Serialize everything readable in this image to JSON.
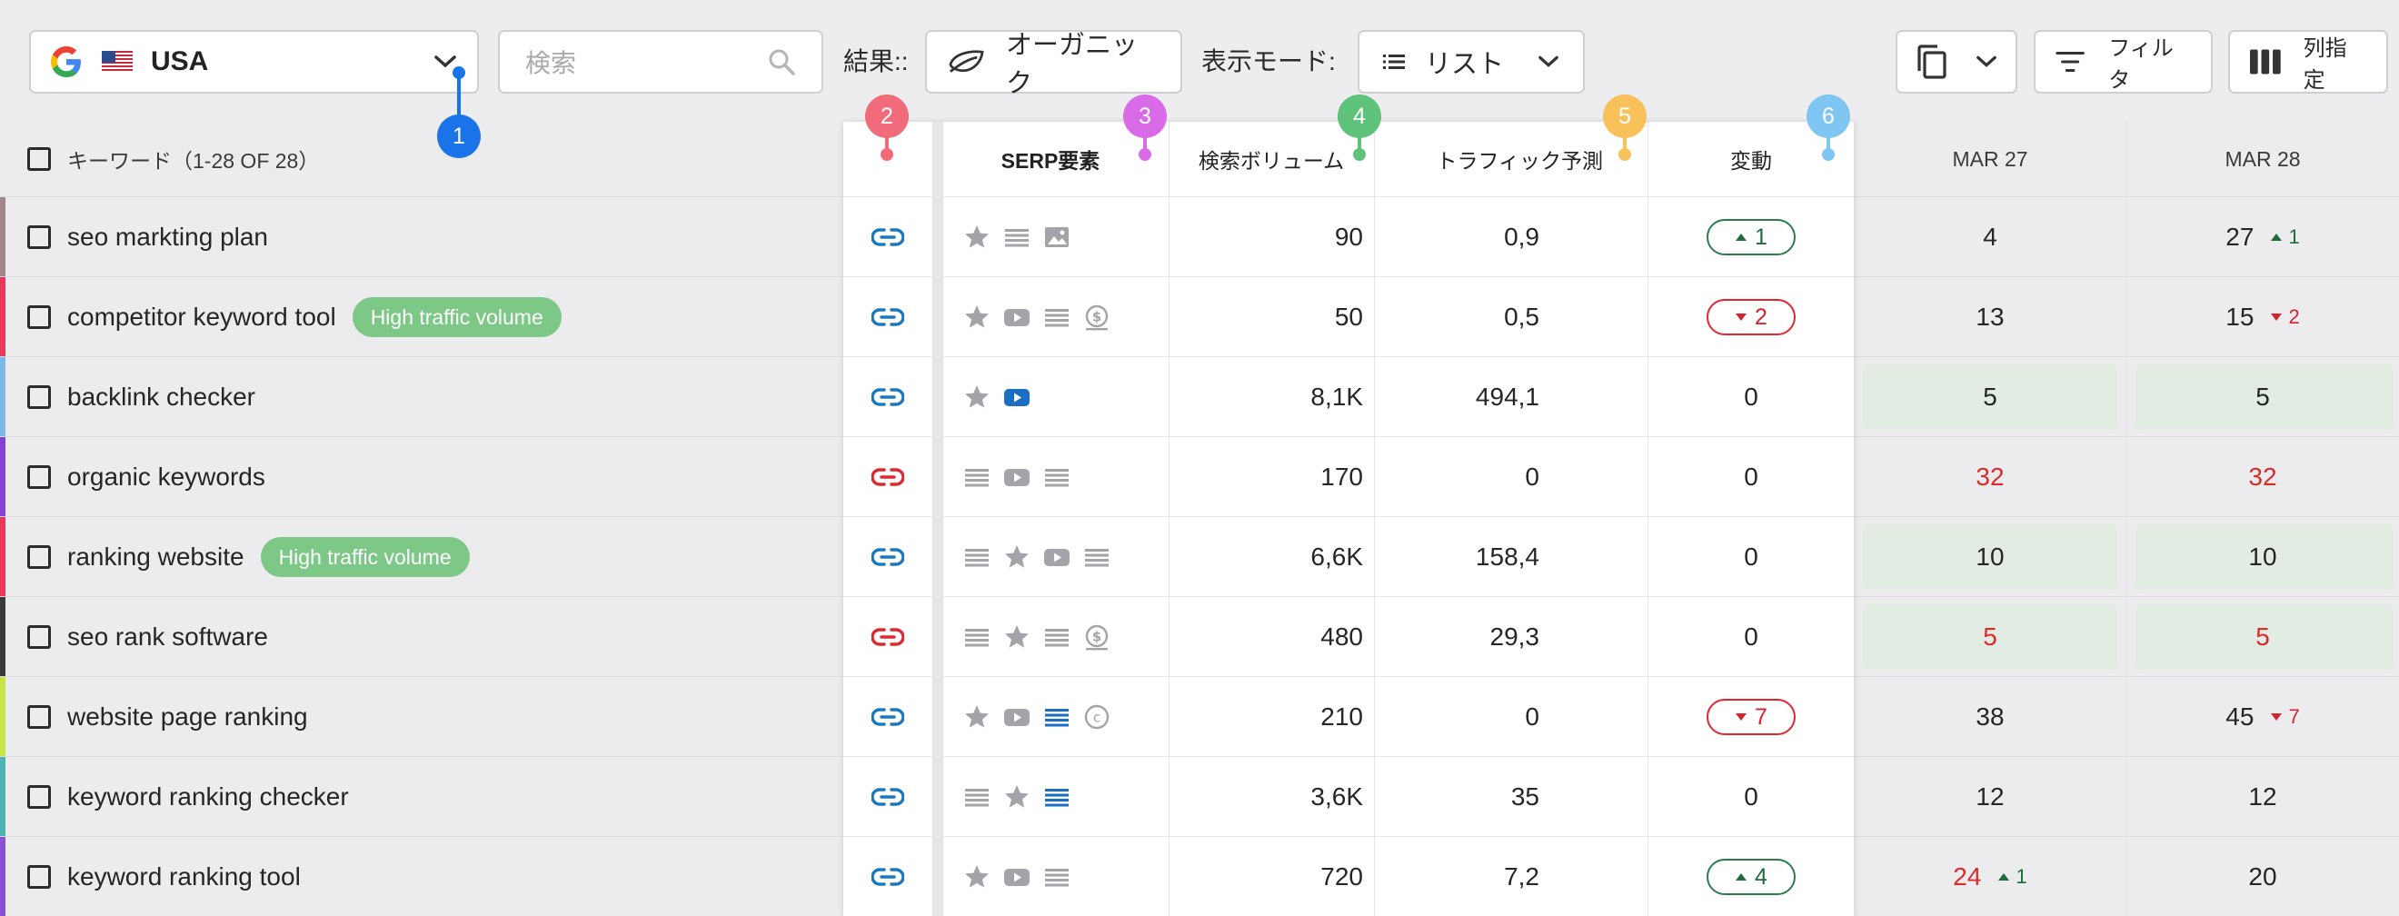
{
  "toolbar": {
    "country": "USA",
    "search_placeholder": "検索",
    "result_label": "結果::",
    "result_value": "オーガニック",
    "mode_label": "表示モード:",
    "mode_value": "リスト",
    "filter_label": "フィルタ",
    "columns_label": "列指定"
  },
  "header": {
    "keyword": "キーワード（1-28 OF 28）",
    "serp": "SERP要素",
    "volume": "検索ボリューム",
    "traffic": "トラフィック予測",
    "change": "変動",
    "date1": "MAR 27",
    "date2": "MAR 28"
  },
  "badges": [
    "1",
    "2",
    "3",
    "4",
    "5",
    "6"
  ],
  "colors": {
    "badge1": "#1a73e8",
    "badge2": "#f26b7a",
    "badge3": "#d96be8",
    "badge4": "#5ec27a",
    "badge5": "#f8c15a",
    "badge6": "#7fc6f2",
    "link_blue": "#1a78c2",
    "link_red": "#e0262f",
    "tag_green": "#7dc787"
  },
  "rows": [
    {
      "keyword": "seo markting plan",
      "tag": "",
      "stripe": "#a0868a",
      "link": "blue",
      "serp": [
        "star",
        "lines",
        "image"
      ],
      "volume": "90",
      "traffic": "0,9",
      "change": {
        "dir": "up",
        "value": "1"
      },
      "d1": "4",
      "d1_red": false,
      "d1_delta": "",
      "d2": "27",
      "d2_red": false,
      "d2_delta": {
        "dir": "up",
        "value": "1"
      },
      "hl": false
    },
    {
      "keyword": "competitor keyword tool",
      "tag": "High traffic volume",
      "stripe": "#e8395a",
      "link": "blue",
      "serp": [
        "star",
        "video",
        "lines",
        "money"
      ],
      "volume": "50",
      "traffic": "0,5",
      "change": {
        "dir": "down",
        "value": "2"
      },
      "d1": "13",
      "d1_red": false,
      "d1_delta": "",
      "d2": "15",
      "d2_red": false,
      "d2_delta": {
        "dir": "down",
        "value": "2"
      },
      "hl": false
    },
    {
      "keyword": "backlink checker",
      "tag": "",
      "stripe": "#7bb9e8",
      "link": "blue",
      "serp": [
        "star",
        "video-blue"
      ],
      "volume": "8,1K",
      "traffic": "494,1",
      "change": {
        "dir": "none",
        "value": "0"
      },
      "d1": "5",
      "d1_red": false,
      "d1_delta": "",
      "d2": "5",
      "d2_red": false,
      "d2_delta": {
        "dir": "",
        "value": ""
      },
      "hl": true
    },
    {
      "keyword": "organic keywords",
      "tag": "",
      "stripe": "#8243d6",
      "link": "red",
      "serp": [
        "lines",
        "video",
        "lines"
      ],
      "volume": "170",
      "traffic": "0",
      "change": {
        "dir": "none",
        "value": "0"
      },
      "d1": "32",
      "d1_red": true,
      "d1_delta": "",
      "d2": "32",
      "d2_red": true,
      "d2_delta": {
        "dir": "",
        "value": ""
      },
      "hl": false
    },
    {
      "keyword": "ranking website",
      "tag": "High traffic volume",
      "stripe": "#e8395a",
      "link": "blue",
      "serp": [
        "lines",
        "star",
        "video",
        "lines"
      ],
      "volume": "6,6K",
      "traffic": "158,4",
      "change": {
        "dir": "none",
        "value": "0"
      },
      "d1": "10",
      "d1_red": false,
      "d1_delta": "",
      "d2": "10",
      "d2_red": false,
      "d2_delta": {
        "dir": "",
        "value": ""
      },
      "hl": true
    },
    {
      "keyword": "seo rank software",
      "tag": "",
      "stripe": "#3a3a3a",
      "link": "red",
      "serp": [
        "lines",
        "star",
        "lines",
        "money"
      ],
      "volume": "480",
      "traffic": "29,3",
      "change": {
        "dir": "none",
        "value": "0"
      },
      "d1": "5",
      "d1_red": true,
      "d1_delta": "",
      "d2": "5",
      "d2_red": true,
      "d2_delta": {
        "dir": "",
        "value": ""
      },
      "hl": true
    },
    {
      "keyword": "website page ranking",
      "tag": "",
      "stripe": "#c7e34a",
      "link": "blue",
      "serp": [
        "star",
        "video",
        "lines-blue",
        "copyright"
      ],
      "volume": "210",
      "traffic": "0",
      "change": {
        "dir": "down",
        "value": "7"
      },
      "d1": "38",
      "d1_red": false,
      "d1_delta": "",
      "d2": "45",
      "d2_red": false,
      "d2_delta": {
        "dir": "down",
        "value": "7"
      },
      "hl": false
    },
    {
      "keyword": "keyword ranking checker",
      "tag": "",
      "stripe": "#4fb3b3",
      "link": "blue",
      "serp": [
        "lines",
        "star",
        "lines-blue"
      ],
      "volume": "3,6K",
      "traffic": "35",
      "change": {
        "dir": "none",
        "value": "0"
      },
      "d1": "12",
      "d1_red": false,
      "d1_delta": "",
      "d2": "12",
      "d2_red": false,
      "d2_delta": {
        "dir": "",
        "value": ""
      },
      "hl": false
    },
    {
      "keyword": "keyword ranking tool",
      "tag": "",
      "stripe": "#8a53d6",
      "link": "blue",
      "serp": [
        "star",
        "video",
        "lines"
      ],
      "volume": "720",
      "traffic": "7,2",
      "change": {
        "dir": "up",
        "value": "4"
      },
      "d1": "24",
      "d1_red": true,
      "d1_delta": {
        "dir": "up",
        "value": "1"
      },
      "d2": "20",
      "d2_red": false,
      "d2_delta": {
        "dir": "",
        "value": ""
      },
      "hl": false
    }
  ]
}
